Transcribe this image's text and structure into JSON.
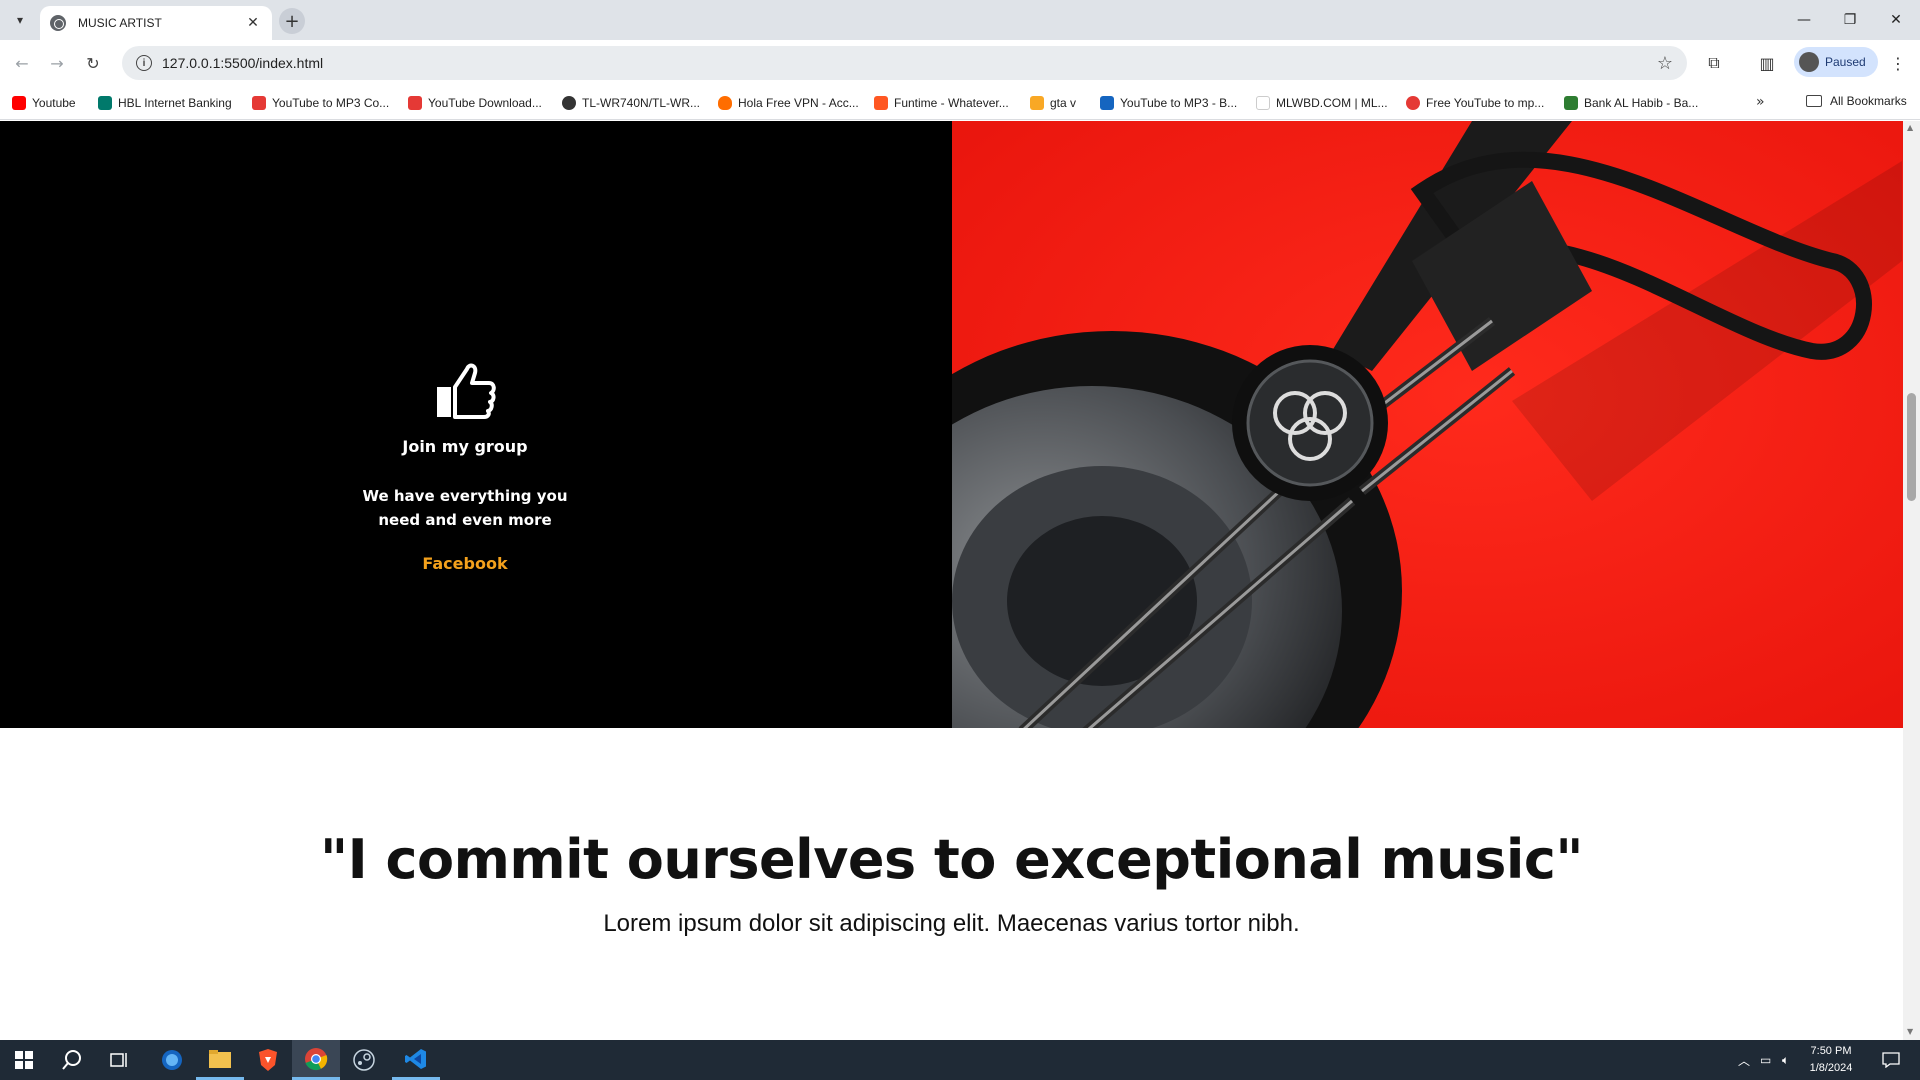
{
  "browser": {
    "tab_title": "MUSIC ARTIST",
    "url": "127.0.0.1:5500/index.html",
    "profile_label": "Paused",
    "new_tab_symbol": "+",
    "close_symbol": "✕"
  },
  "bookmarks": {
    "items": [
      {
        "label": "Youtube",
        "color": "#ff0000"
      },
      {
        "label": "HBL Internet Banking",
        "color": "#00796b"
      },
      {
        "label": "YouTube to MP3 Co...",
        "color": "#e53935"
      },
      {
        "label": "YouTube Download...",
        "color": "#e53935"
      },
      {
        "label": "TL-WR740N/TL-WR...",
        "color": "#333333"
      },
      {
        "label": "Hola Free VPN - Acc...",
        "color": "#ff6d00"
      },
      {
        "label": "Funtime - Whatever...",
        "color": "#ff5722"
      },
      {
        "label": "gta v",
        "color": "#f9a825"
      },
      {
        "label": "YouTube to MP3 - B...",
        "color": "#1565c0"
      },
      {
        "label": "MLWBD.COM | ML...",
        "color": "#ffffff"
      },
      {
        "label": "Free YouTube to mp...",
        "color": "#e53935"
      },
      {
        "label": "Bank AL Habib - Ba...",
        "color": "#2e7d32"
      }
    ],
    "all_label": "All Bookmarks",
    "more_symbol": "»"
  },
  "hero": {
    "title": "Join my group",
    "text_line1": "We have everything you",
    "text_line2": "need and even more",
    "link": "Facebook",
    "link_color": "#f4a11c"
  },
  "quote": {
    "heading": "\"I commit ourselves to exceptional music\"",
    "subtext": "Lorem ipsum dolor sit adipiscing elit. Maecenas varius tortor nibh."
  },
  "taskbar": {
    "time": "7:50 PM",
    "date": "1/8/2024"
  }
}
